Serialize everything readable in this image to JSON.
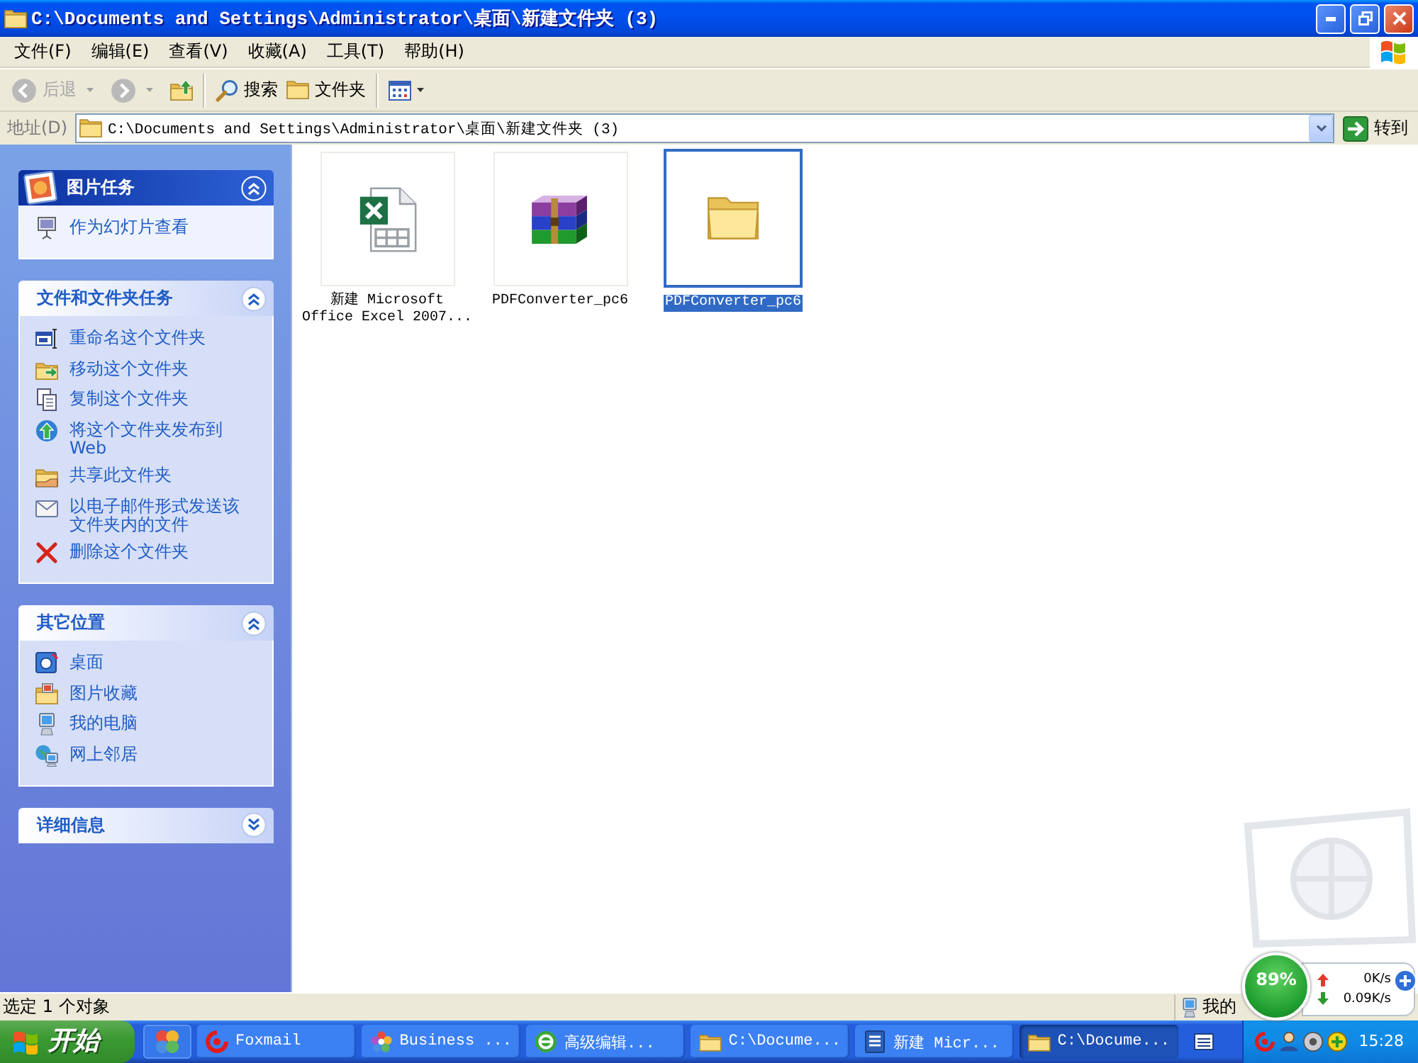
{
  "window": {
    "title": "C:\\Documents and Settings\\Administrator\\桌面\\新建文件夹 (3)"
  },
  "menu": [
    "文件(F)",
    "编辑(E)",
    "查看(V)",
    "收藏(A)",
    "工具(T)",
    "帮助(H)"
  ],
  "toolbar": [
    {
      "kind": "back",
      "label": "后退",
      "disabled": true
    },
    {
      "kind": "forward",
      "disabled": true
    },
    {
      "kind": "up",
      "disabled": false
    },
    {
      "kind": "separator"
    },
    {
      "kind": "search",
      "label": "搜索",
      "disabled": false
    },
    {
      "kind": "folders",
      "label": "文件夹",
      "disabled": false
    },
    {
      "kind": "separator"
    },
    {
      "kind": "views",
      "disabled": false
    }
  ],
  "address": {
    "label": "地址(D)",
    "value": "C:\\Documents and Settings\\Administrator\\桌面\\新建文件夹 (3)",
    "go_label": "转到"
  },
  "task_panes": [
    {
      "kind": "special",
      "title": "图片任务",
      "expanded": true,
      "items": [
        {
          "kind": "slideshow",
          "label": "作为幻灯片查看"
        }
      ]
    },
    {
      "kind": "normal",
      "title": "文件和文件夹任务",
      "expanded": true,
      "items": [
        {
          "kind": "rename",
          "label": "重命名这个文件夹"
        },
        {
          "kind": "move",
          "label": "移动这个文件夹"
        },
        {
          "kind": "copy",
          "label": "复制这个文件夹"
        },
        {
          "kind": "publish",
          "label": "将这个文件夹发布到 Web"
        },
        {
          "kind": "share",
          "label": "共享此文件夹"
        },
        {
          "kind": "email",
          "label": "以电子邮件形式发送该文件夹内的文件"
        },
        {
          "kind": "delete",
          "label": "删除这个文件夹"
        }
      ]
    },
    {
      "kind": "normal",
      "title": "其它位置",
      "expanded": true,
      "items": [
        {
          "kind": "desktop",
          "label": "桌面"
        },
        {
          "kind": "pictures",
          "label": "图片收藏"
        },
        {
          "kind": "computer",
          "label": "我的电脑"
        },
        {
          "kind": "network",
          "label": "网上邻居"
        }
      ]
    },
    {
      "kind": "normal",
      "title": "详细信息",
      "expanded": false
    }
  ],
  "files": [
    {
      "kind": "excel",
      "name": "新建 Microsoft Office Excel 2007...",
      "selected": false
    },
    {
      "kind": "archive",
      "name": "PDFConverter_pc6",
      "selected": false
    },
    {
      "kind": "folder",
      "name": "PDFConverter_pc6",
      "selected": true
    }
  ],
  "status_bar": {
    "text": "选定 1 个对象",
    "zone": "我的"
  },
  "speed_widget": {
    "percent": "89%",
    "upload": "0K/s",
    "download": "0.09K/s"
  },
  "taskbar": {
    "start": "开始",
    "buttons": [
      {
        "kind": "foxmail",
        "label": "Foxmail",
        "selected": false
      },
      {
        "kind": "flower",
        "label": "Business ...",
        "selected": false
      },
      {
        "kind": "browser",
        "label": "高级编辑...",
        "selected": false
      },
      {
        "kind": "folder",
        "label": "C:\\Docume...",
        "selected": false
      },
      {
        "kind": "word",
        "label": "新建 Micr...",
        "selected": false
      },
      {
        "kind": "folder",
        "label": "C:\\Docume...",
        "selected": true
      }
    ],
    "clock": "15:28"
  }
}
